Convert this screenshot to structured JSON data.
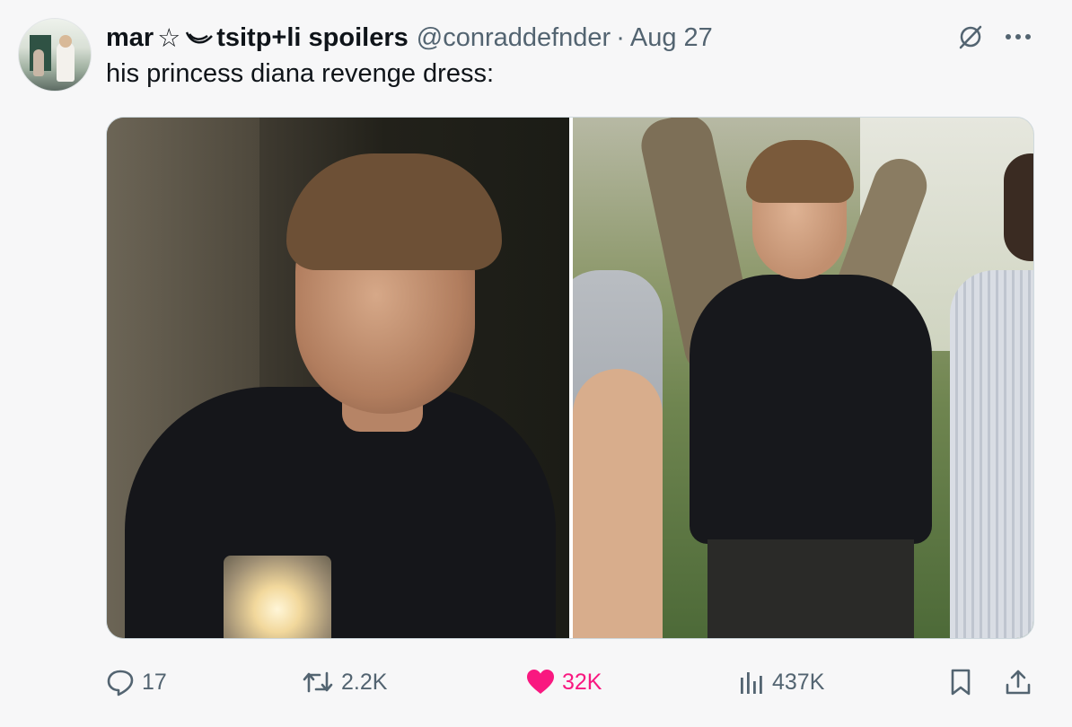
{
  "tweet": {
    "display_name_part1": "mar",
    "display_name_glyph1": "☆",
    "display_name_glyph2": "⚓",
    "display_name_part2": "tsitp+li spoilers",
    "handle": "@conraddefnder",
    "separator": "·",
    "date": "Aug 27",
    "text": "his princess diana revenge dress:"
  },
  "actions": {
    "replies": "17",
    "retweets": "2.2K",
    "likes": "32K",
    "views": "437K"
  },
  "colors": {
    "like_active": "#f91880",
    "secondary_text": "#536471",
    "primary_text": "#0f1419"
  },
  "icons": {
    "grok": "grok-icon",
    "more": "more-icon",
    "reply": "reply-icon",
    "retweet": "retweet-icon",
    "like": "heart-icon",
    "views": "views-icon",
    "bookmark": "bookmark-icon",
    "share": "share-icon"
  }
}
